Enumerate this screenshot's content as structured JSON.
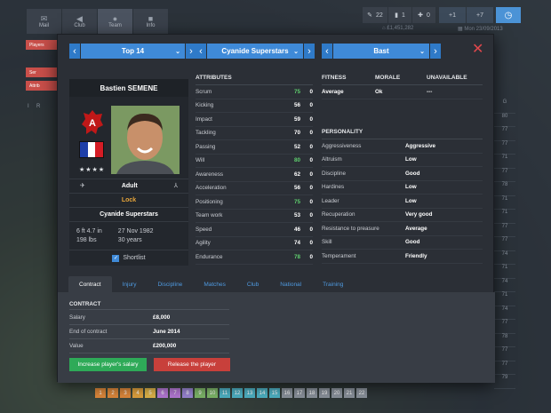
{
  "nav": [
    {
      "label": "Mail",
      "icon": "mail-icon"
    },
    {
      "label": "Club",
      "icon": "megaphone-icon"
    },
    {
      "label": "Team",
      "icon": "team-icon"
    },
    {
      "label": "Info",
      "icon": "briefcase-icon"
    }
  ],
  "stats": {
    "a": "22",
    "b": "1",
    "c": "0",
    "d": "+1",
    "e": "+7"
  },
  "under_stats": {
    "money": "£1,451,282",
    "date": "Mon 23/09/2013"
  },
  "side": {
    "players_tab": "Players",
    "tab2": "Ser",
    "tab3": "Attrib",
    "col_a": "I",
    "col_b": "R"
  },
  "right_col": {
    "header": "G",
    "values": [
      "80",
      "77",
      "77",
      "71",
      "77",
      "78",
      "71",
      "71",
      "77",
      "77",
      "74",
      "71",
      "74",
      "71",
      "74",
      "77",
      "78",
      "77",
      "77",
      "79",
      "77",
      "77"
    ]
  },
  "selectors": {
    "league": "Top 14",
    "club": "Cyanide Superstars",
    "group": "Bast"
  },
  "player": {
    "name": "Bastien SEMENE",
    "stars": "★★★★",
    "age_group": "Adult",
    "lock": "Lock",
    "club": "Cyanide Superstars",
    "height": "6 ft 4.7 in",
    "weight": "198 lbs",
    "birth": "27 Nov 1982",
    "age": "30 years",
    "shortlist": "Shortlist"
  },
  "attributes": {
    "header": "ATTRIBUTES",
    "rows": [
      {
        "name": "Scrum",
        "value": "75",
        "diff": "0",
        "green": true
      },
      {
        "name": "Kicking",
        "value": "56",
        "diff": "0",
        "green": false
      },
      {
        "name": "Impact",
        "value": "59",
        "diff": "0",
        "green": false
      },
      {
        "name": "Tackling",
        "value": "70",
        "diff": "0",
        "green": false
      },
      {
        "name": "Passing",
        "value": "52",
        "diff": "0",
        "green": false
      },
      {
        "name": "Will",
        "value": "80",
        "diff": "0",
        "green": true
      },
      {
        "name": "Awareness",
        "value": "62",
        "diff": "0",
        "green": false
      },
      {
        "name": "Acceleration",
        "value": "56",
        "diff": "0",
        "green": false
      },
      {
        "name": "Positioning",
        "value": "75",
        "diff": "0",
        "green": true
      },
      {
        "name": "Team work",
        "value": "53",
        "diff": "0",
        "green": false
      },
      {
        "name": "Speed",
        "value": "46",
        "diff": "0",
        "green": false
      },
      {
        "name": "Agility",
        "value": "74",
        "diff": "0",
        "green": false
      },
      {
        "name": "Endurance",
        "value": "78",
        "diff": "0",
        "green": true
      }
    ]
  },
  "fitness": {
    "h1": "FITNESS",
    "h2": "MORALE",
    "h3": "UNAVAILABLE",
    "v1": "Average",
    "v2": "Ok",
    "v3": "---"
  },
  "personality": {
    "header": "PERSONALITY",
    "rows": [
      {
        "name": "Aggressiveness",
        "value": "Aggressive"
      },
      {
        "name": "Altruism",
        "value": "Low"
      },
      {
        "name": "Discipline",
        "value": "Good"
      },
      {
        "name": "Hardines",
        "value": "Low"
      },
      {
        "name": "Leader",
        "value": "Low"
      },
      {
        "name": "Recuperation",
        "value": "Very good"
      },
      {
        "name": "Resistance to preasure",
        "value": "Average"
      },
      {
        "name": "Skill",
        "value": "Good"
      },
      {
        "name": "Temperament",
        "value": "Friendly"
      }
    ]
  },
  "tabs": [
    "Contract",
    "Injury",
    "Discipline",
    "Matches",
    "Club",
    "National",
    "Training"
  ],
  "contract": {
    "header": "CONTRACT",
    "rows": [
      {
        "label": "Salary",
        "value": "£8,000"
      },
      {
        "label": "End of contract",
        "value": "June 2014"
      },
      {
        "label": "Value",
        "value": "£200,000"
      }
    ],
    "increase_btn": "Increase player's salary",
    "release_btn": "Release the player"
  },
  "pages": [
    "1",
    "2",
    "3",
    "4",
    "5",
    "6",
    "7",
    "8",
    "9",
    "10",
    "11",
    "12",
    "13",
    "14",
    "15",
    "16",
    "17",
    "18",
    "19",
    "20",
    "21",
    "22"
  ],
  "colors": {
    "accent": "#3f8ad8",
    "green": "#2eaa58",
    "red": "#c8403b",
    "stat_green": "#5fcf6e"
  }
}
